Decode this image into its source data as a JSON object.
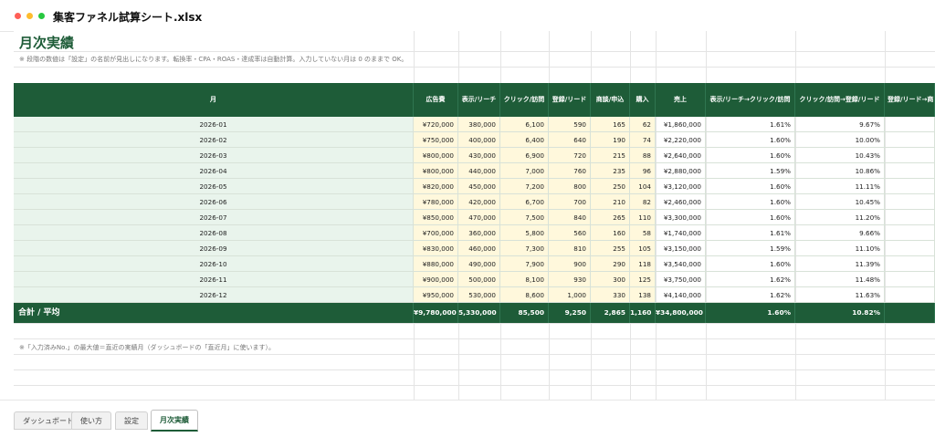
{
  "window": {
    "title": "集客ファネル試算シート.xlsx"
  },
  "sheet": {
    "title": "月次実績",
    "note": "※ 段階の数値は「設定」の名前が見出しになります。転換率・CPA・ROAS・達成率は自動計算。入力していない月は 0 のままで OK。",
    "footnote": "※「入力済みNo.」の最大値＝直近の実績月（ダッシュボードの「直近月」に使います）。"
  },
  "table": {
    "headers": [
      "月",
      "広告費",
      "表示/リーチ",
      "クリック/訪問",
      "登録/リード",
      "商談/申込",
      "購入",
      "売上",
      "表示/リーチ→クリック/訪問",
      "クリック/訪問→登録/リード",
      "登録/リード→商"
    ],
    "rows": [
      [
        "2026-01",
        "¥720,000",
        "380,000",
        "6,100",
        "590",
        "165",
        "62",
        "¥1,860,000",
        "1.61%",
        "9.67%"
      ],
      [
        "2026-02",
        "¥750,000",
        "400,000",
        "6,400",
        "640",
        "190",
        "74",
        "¥2,220,000",
        "1.60%",
        "10.00%"
      ],
      [
        "2026-03",
        "¥800,000",
        "430,000",
        "6,900",
        "720",
        "215",
        "88",
        "¥2,640,000",
        "1.60%",
        "10.43%"
      ],
      [
        "2026-04",
        "¥800,000",
        "440,000",
        "7,000",
        "760",
        "235",
        "96",
        "¥2,880,000",
        "1.59%",
        "10.86%"
      ],
      [
        "2026-05",
        "¥820,000",
        "450,000",
        "7,200",
        "800",
        "250",
        "104",
        "¥3,120,000",
        "1.60%",
        "11.11%"
      ],
      [
        "2026-06",
        "¥780,000",
        "420,000",
        "6,700",
        "700",
        "210",
        "82",
        "¥2,460,000",
        "1.60%",
        "10.45%"
      ],
      [
        "2026-07",
        "¥850,000",
        "470,000",
        "7,500",
        "840",
        "265",
        "110",
        "¥3,300,000",
        "1.60%",
        "11.20%"
      ],
      [
        "2026-08",
        "¥700,000",
        "360,000",
        "5,800",
        "560",
        "160",
        "58",
        "¥1,740,000",
        "1.61%",
        "9.66%"
      ],
      [
        "2026-09",
        "¥830,000",
        "460,000",
        "7,300",
        "810",
        "255",
        "105",
        "¥3,150,000",
        "1.59%",
        "11.10%"
      ],
      [
        "2026-10",
        "¥880,000",
        "490,000",
        "7,900",
        "900",
        "290",
        "118",
        "¥3,540,000",
        "1.60%",
        "11.39%"
      ],
      [
        "2026-11",
        "¥900,000",
        "500,000",
        "8,100",
        "930",
        "300",
        "125",
        "¥3,750,000",
        "1.62%",
        "11.48%"
      ],
      [
        "2026-12",
        "¥950,000",
        "530,000",
        "8,600",
        "1,000",
        "330",
        "138",
        "¥4,140,000",
        "1.62%",
        "11.63%"
      ]
    ],
    "total": [
      "合計 / 平均",
      "¥9,780,000",
      "5,330,000",
      "85,500",
      "9,250",
      "2,865",
      "1,160",
      "¥34,800,000",
      "1.60%",
      "10.82%"
    ]
  },
  "tabs": [
    {
      "label": "ダッシュボード",
      "active": false
    },
    {
      "label": "使い方",
      "active": false
    },
    {
      "label": "設定",
      "active": false
    },
    {
      "label": "月次実績",
      "active": true
    }
  ],
  "colors": {
    "header_green": "#1e5c38",
    "title_green": "#1e5c38",
    "input_yellow": "#fff8dc",
    "month_green": "#e9f4ec"
  }
}
